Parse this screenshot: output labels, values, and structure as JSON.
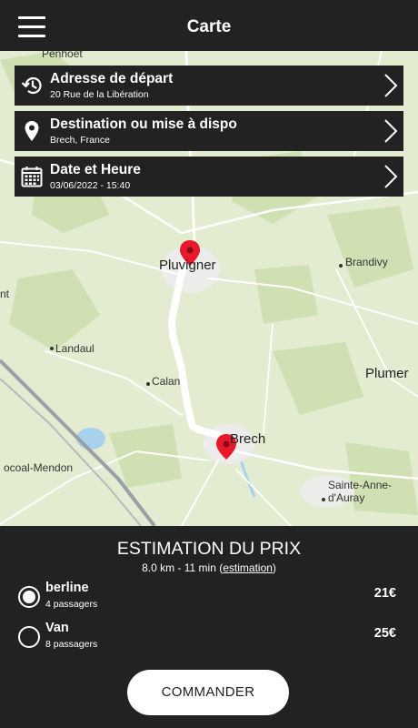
{
  "header": {
    "title": "Carte",
    "menu_icon": "hamburger-menu-icon"
  },
  "form": {
    "departure": {
      "title": "Adresse de départ",
      "value": "20 Rue de la Libération",
      "icon": "history-icon"
    },
    "destination": {
      "title": "Destination ou mise à dispo",
      "value": "Brech, France",
      "icon": "location-pin-icon"
    },
    "datetime": {
      "title": "Date et Heure",
      "value": "03/06/2022 - 15:40",
      "icon": "calendar-icon"
    }
  },
  "map": {
    "labels": {
      "penhoet": "Penhoët",
      "pluvigner": "Pluvigner",
      "brandivy": "Brandivy",
      "landaul": "Landaul",
      "calan": "Calan",
      "plumergat": "Plumer",
      "brech": "Brech",
      "locoal": "ocoal-Mendon",
      "sainte_anne_1": "Sainte-Anne-",
      "sainte_anne_2": "d'Auray",
      "left_edge": "nt"
    },
    "route_color": "#ffffff",
    "marker_color": "#e8192c"
  },
  "estimate": {
    "title": "ESTIMATION DU PRIX",
    "summary": "8.0 km - 11 min (",
    "link": "estimation",
    "summary_end": ")"
  },
  "options": [
    {
      "name": "berline",
      "subtitle": "4 passagers",
      "price": "21€",
      "selected": true
    },
    {
      "name": "Van",
      "subtitle": "8 passagers",
      "price": "25€",
      "selected": false
    }
  ],
  "order_button": "COMMANDER"
}
